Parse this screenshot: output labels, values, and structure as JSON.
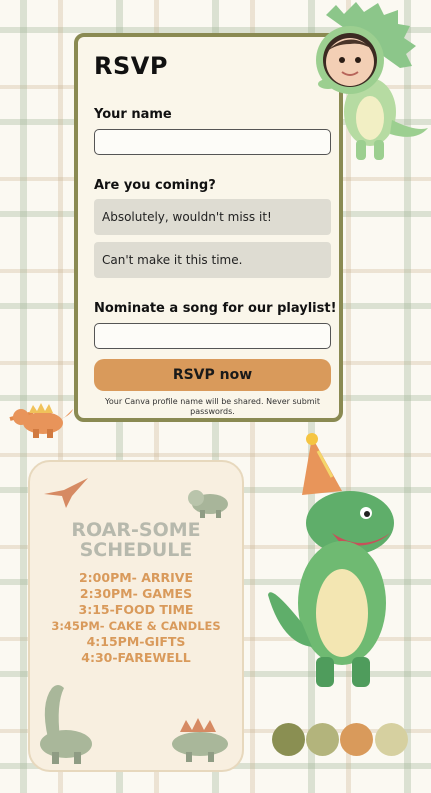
{
  "rsvp": {
    "title": "RSVP",
    "name_label": "Your name",
    "name_value": "",
    "coming_label": "Are you coming?",
    "options": [
      "Absolutely, wouldn't miss it!",
      "Can't make it this time."
    ],
    "song_label": "Nominate a song for our playlist!",
    "song_value": "",
    "submit_label": "RSVP now",
    "disclaimer": "Your Canva profile name will be shared. Never submit passwords."
  },
  "schedule": {
    "title_line1": "ROAR-SOME",
    "title_line2": "SCHEDULE",
    "items": [
      "2:00PM- ARRIVE",
      "2:30PM- GAMES",
      "3:15-FOOD TIME",
      "3:45PM- CAKE & CANDLES",
      "4:15PM-GIFTS",
      "4:30-FAREWELL"
    ]
  },
  "colors": {
    "accent": "#d99a5b",
    "border": "#8a8a52",
    "palette": [
      "#8a8f52",
      "#b3b47c",
      "#d99a5b",
      "#d6d0a0"
    ]
  },
  "icons": [
    "baby-dinosaur-avatar",
    "orange-dinosaur-icon",
    "green-trex-party-hat",
    "pterodactyl-icon",
    "triceratops-icon",
    "brachiosaurus-icon",
    "stegosaurus-icon"
  ]
}
